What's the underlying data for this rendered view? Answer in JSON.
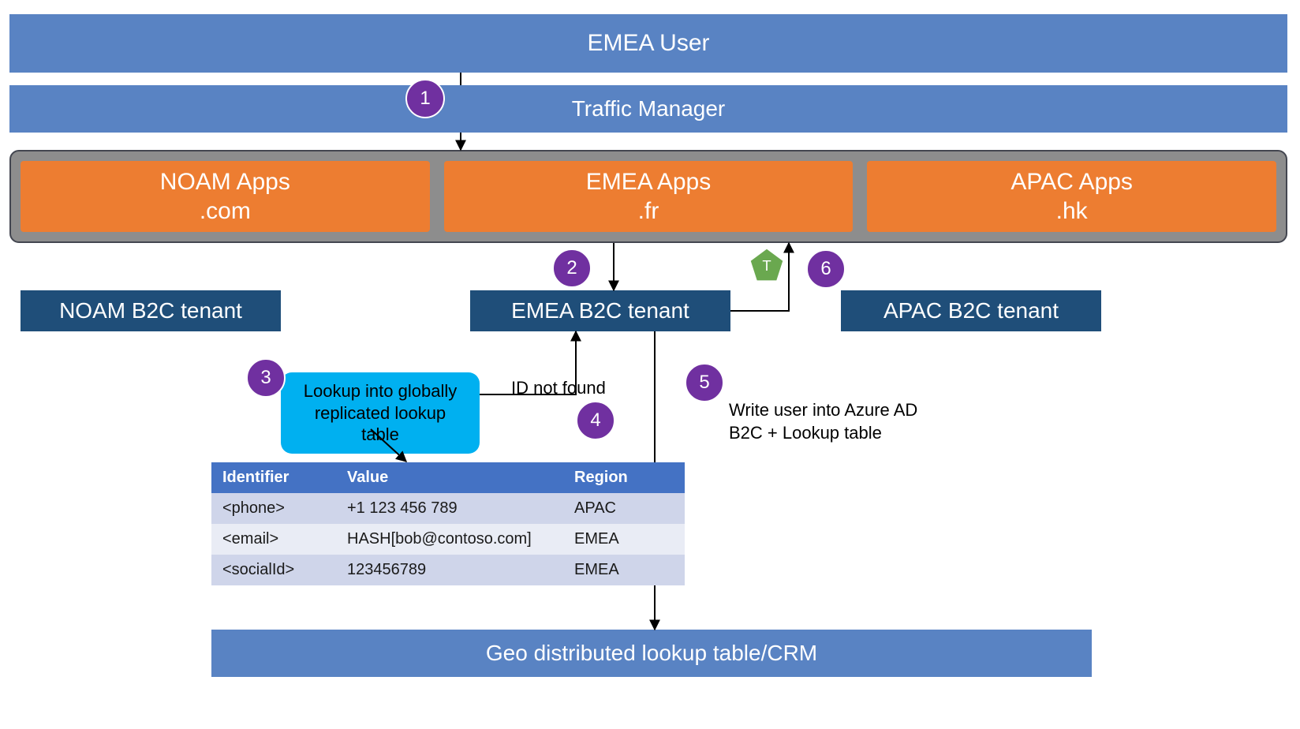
{
  "header": {
    "emea_user": "EMEA User",
    "traffic_manager": "Traffic Manager"
  },
  "apps": {
    "noam": {
      "title": "NOAM Apps",
      "tld": ".com"
    },
    "emea": {
      "title": "EMEA Apps",
      "tld": ".fr"
    },
    "apac": {
      "title": "APAC Apps",
      "tld": ".hk"
    }
  },
  "tenants": {
    "noam": "NOAM B2C tenant",
    "emea": "EMEA B2C tenant",
    "apac": "APAC B2C tenant"
  },
  "notes": {
    "lookup": "Lookup into globally\nreplicated lookup table",
    "id_not_found": "ID not found",
    "write_user": "Write user into Azure AD\nB2C + Lookup table"
  },
  "steps": {
    "1": "1",
    "2": "2",
    "3": "3",
    "4": "4",
    "5": "5",
    "6": "6"
  },
  "token_badge": "T",
  "table": {
    "headers": [
      "Identifier",
      "Value",
      "Region"
    ],
    "rows": [
      {
        "identifier": "<phone>",
        "value": "+1 123 456 789",
        "region": "APAC"
      },
      {
        "identifier": "<email>",
        "value": "HASH[bob@contoso.com]",
        "region": "EMEA"
      },
      {
        "identifier": "<socialId>",
        "value": "123456789",
        "region": "EMEA"
      }
    ]
  },
  "footer": {
    "geo_crm": "Geo distributed lookup table/CRM"
  }
}
